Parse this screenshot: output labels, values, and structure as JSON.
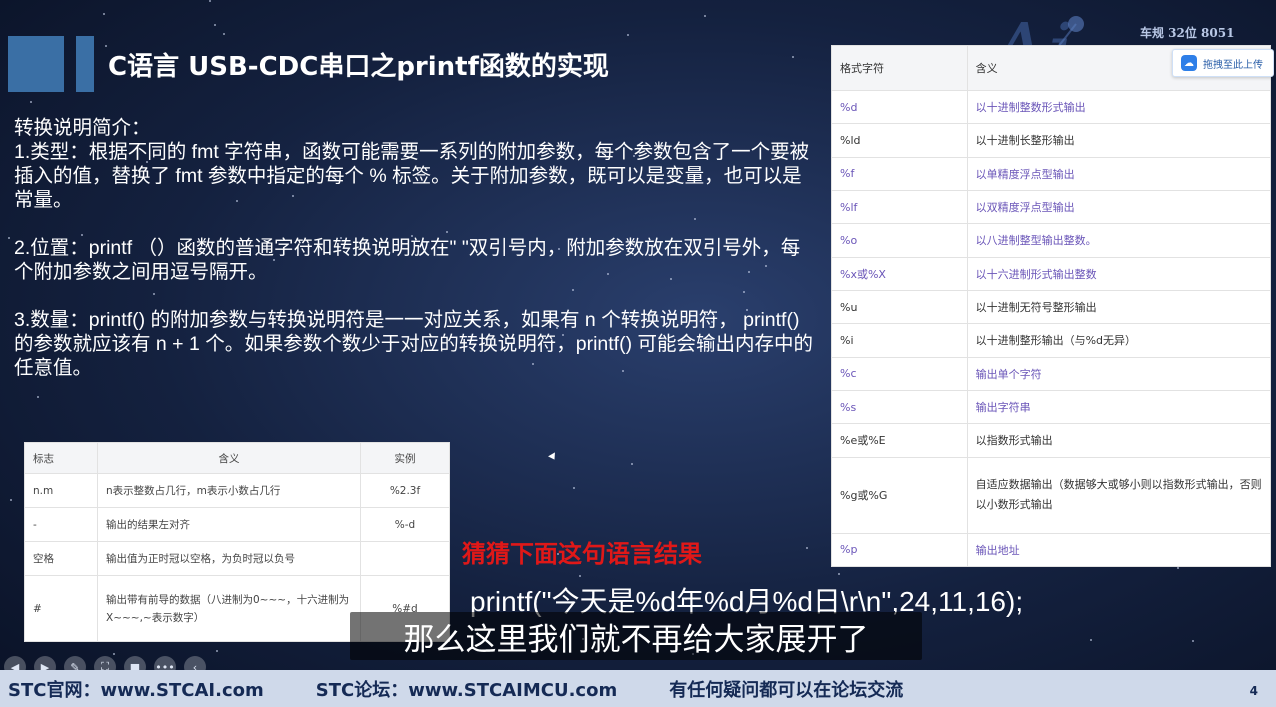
{
  "slide": {
    "title": "C语言 USB-CDC串口之printf函数的实现",
    "logo_text": "车规 32位 8051",
    "page_number": "4"
  },
  "body": {
    "paragraphs": [
      "转换说明简介：\n1.类型：根据不同的 fmt 字符串，函数可能需要一系列的附加参数，每个参数包含了一个要被插入的值，替换了 fmt 参数中指定的每个 % 标签。关于附加参数，既可以是变量，也可以是常量。",
      "2.位置：printf （）函数的普通字符和转换说明放在\" \"双引号内，附加参数放在双引号外，每个附加参数之间用逗号隔开。",
      "3.数量：printf() 的附加参数与转换说明符是一一对应关系，如果有 n 个转换说明符， printf() 的参数就应该有 n + 1 个。如果参数个数少于对应的转换说明符，printf() 可能会输出内存中的任意值。"
    ]
  },
  "fmt_table": {
    "headers": [
      "格式字符",
      "含义"
    ],
    "rows": [
      [
        "%d",
        "以十进制整数形式输出"
      ],
      [
        "%ld",
        "以十进制长整形输出"
      ],
      [
        "%f",
        "以单精度浮点型输出"
      ],
      [
        "%lf",
        "以双精度浮点型输出"
      ],
      [
        "%o",
        "以八进制整型输出整数。"
      ],
      [
        "%x或%X",
        "以十六进制形式输出整数"
      ],
      [
        "%u",
        "以十进制无符号整形输出"
      ],
      [
        "%i",
        "以十进制整形输出（与%d无异）"
      ],
      [
        "%c",
        "输出单个字符"
      ],
      [
        "%s",
        "输出字符串"
      ],
      [
        "%e或%E",
        "以指数形式输出"
      ],
      [
        "%g或%G",
        "自适应数据输出（数据够大或够小则以指数形式输出，否则以小数形式输出"
      ],
      [
        "%p",
        "输出地址"
      ]
    ],
    "upload_button": "拖拽至此上传"
  },
  "flag_table": {
    "headers": [
      "标志",
      "含义",
      "实例"
    ],
    "rows": [
      [
        "n.m",
        "n表示整数占几行，m表示小数占几行",
        "%2.3f"
      ],
      [
        "-",
        "输出的结果左对齐",
        "%-d"
      ],
      [
        "空格",
        "输出值为正时冠以空格，为负时冠以负号",
        ""
      ],
      [
        "#",
        "输出带有前导的数据（八进制为0~~~，十六进制为X~~~,~表示数字）",
        "%#d"
      ]
    ]
  },
  "guess_text": "猜猜下面这句语言结果",
  "code_line": "printf(\"今天是%d年%d月%d日\\r\\n\",24,11,16);",
  "subtitle": "那么这里我们就不再给大家展开了",
  "footer": {
    "site": "STC官网：www.STCAI.com",
    "forum": "STC论坛：www.STCAIMCU.com",
    "note": "有任何疑问都可以在论坛交流"
  },
  "player": {
    "buttons": [
      "◀",
      "▶",
      "✎",
      "⛶",
      "■",
      "•••",
      "‹"
    ]
  },
  "colors": {
    "title_accent": "#3a6fa5",
    "guess": "#e01818",
    "footer_bg": "#cfd9ea",
    "footer_text": "#152a55",
    "table_link": "#6a55b8"
  }
}
